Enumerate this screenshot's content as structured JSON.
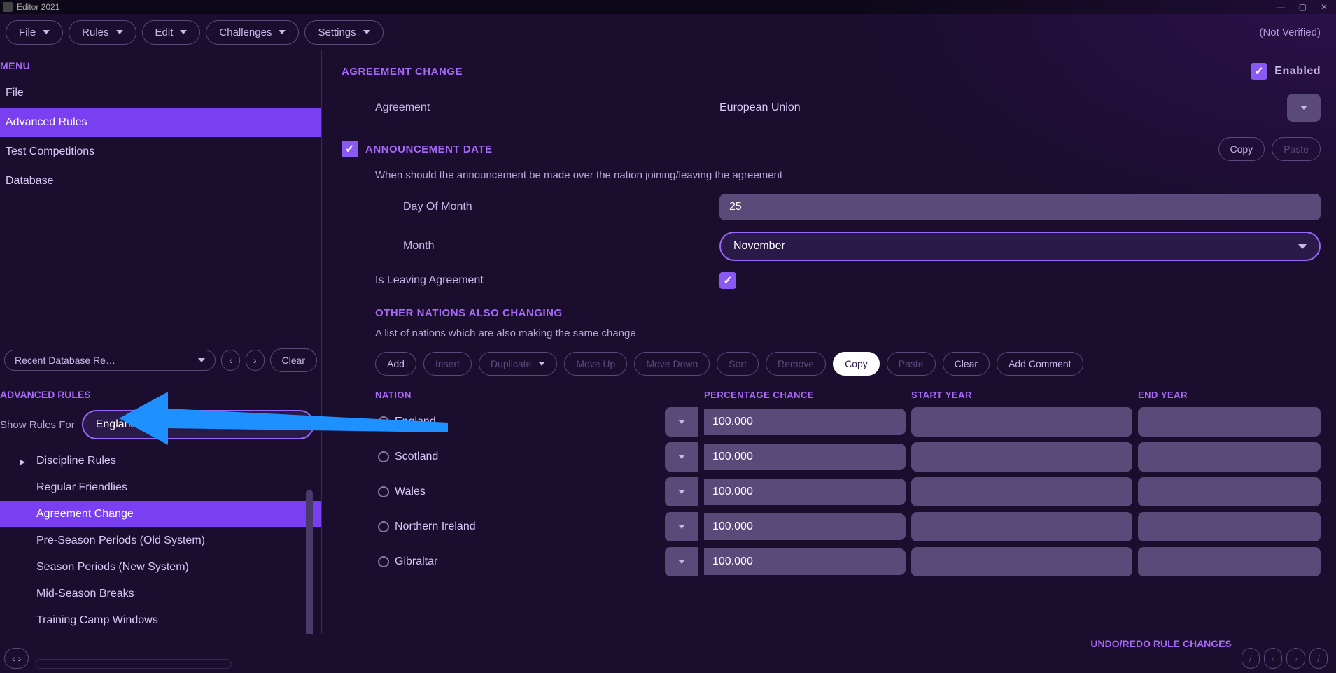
{
  "titlebar": {
    "title": "Editor 2021"
  },
  "menubar": {
    "items": [
      "File",
      "Rules",
      "Edit",
      "Challenges",
      "Settings"
    ],
    "status": "(Not Verified)"
  },
  "sidebar": {
    "menu_label": "MENU",
    "items": [
      "File",
      "Advanced Rules",
      "Test Competitions",
      "Database"
    ],
    "active_index": 1,
    "recent_label": "Recent Database Re…",
    "clear_label": "Clear",
    "adv_label": "ADVANCED RULES",
    "show_for_label": "Show Rules For",
    "show_for_value": "England",
    "tree": [
      {
        "label": "Discipline Rules",
        "expandable": true
      },
      {
        "label": "Regular Friendlies"
      },
      {
        "label": "Agreement Change",
        "active": true
      },
      {
        "label": "Pre-Season Periods (Old System)"
      },
      {
        "label": "Season Periods (New System)"
      },
      {
        "label": "Mid-Season Breaks"
      },
      {
        "label": "Training Camp Windows"
      }
    ]
  },
  "content": {
    "title": "AGREEMENT CHANGE",
    "enabled_label": "Enabled",
    "agreement_label": "Agreement",
    "agreement_value": "European Union",
    "ann_date_label": "ANNOUNCEMENT DATE",
    "ann_date_desc": "When should the announcement be made over the nation joining/leaving the agreement",
    "copy_label": "Copy",
    "paste_label": "Paste",
    "day_label": "Day Of Month",
    "day_value": "25",
    "month_label": "Month",
    "month_value": "November",
    "leaving_label": "Is Leaving Agreement",
    "other_label": "OTHER NATIONS ALSO CHANGING",
    "other_desc": "A list of nations which are also making the same change",
    "buttons": {
      "add": "Add",
      "insert": "Insert",
      "duplicate": "Duplicate",
      "moveup": "Move Up",
      "movedown": "Move Down",
      "sort": "Sort",
      "remove": "Remove",
      "copy": "Copy",
      "paste": "Paste",
      "clear": "Clear",
      "comment": "Add Comment"
    },
    "cols": {
      "nation": "NATION",
      "pct": "PERCENTAGE CHANCE",
      "start": "START YEAR",
      "end": "END YEAR"
    },
    "rows": [
      {
        "nation": "England",
        "pct": "100.000",
        "start": "",
        "end": ""
      },
      {
        "nation": "Scotland",
        "pct": "100.000",
        "start": "",
        "end": ""
      },
      {
        "nation": "Wales",
        "pct": "100.000",
        "start": "",
        "end": ""
      },
      {
        "nation": "Northern Ireland",
        "pct": "100.000",
        "start": "",
        "end": ""
      },
      {
        "nation": "Gibraltar",
        "pct": "100.000",
        "start": "",
        "end": ""
      }
    ]
  },
  "footer": {
    "undo_label": "UNDO/REDO RULE CHANGES"
  }
}
